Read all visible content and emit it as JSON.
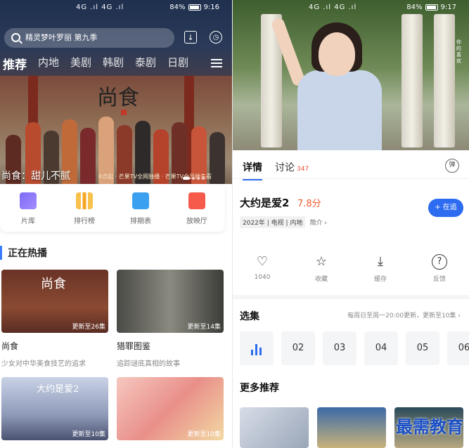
{
  "left": {
    "status": {
      "network": "4G .ıl 4G .ıl",
      "battery": "84%",
      "time": "9:16"
    },
    "search": {
      "placeholder": "精灵梦叶罗丽 第九季"
    },
    "nav_tabs": [
      "推荐",
      "内地",
      "美剧",
      "韩剧",
      "泰剧",
      "日剧"
    ],
    "banner": {
      "logo": "尚食",
      "caption": "尚食：甜儿不腻",
      "sub": "8点起 · 芒果TV全网独播 · 芒果TV会员抢先看"
    },
    "quick_links": [
      {
        "label": "片库",
        "icon": "grid-icon"
      },
      {
        "label": "排行榜",
        "icon": "chart-icon"
      },
      {
        "label": "排期表",
        "icon": "calendar-icon"
      },
      {
        "label": "放映厅",
        "icon": "play-icon"
      }
    ],
    "section_title": "正在热播",
    "cards": [
      {
        "title": "尚食",
        "subtitle": "少女对中华美食技艺的追求",
        "badge": "更新至26集",
        "logo": "尚食"
      },
      {
        "title": "猎罪图鉴",
        "subtitle": "追踪谜底真相的故事",
        "badge": "更新至14集",
        "logo": ""
      },
      {
        "title": "",
        "subtitle": "",
        "badge": "更新至10集",
        "logo": "大约是爱2"
      },
      {
        "title": "",
        "subtitle": "",
        "badge": "更新至10集",
        "logo": ""
      }
    ]
  },
  "right": {
    "status": {
      "network": "4G .ıl 4G .ıl",
      "battery": "84%",
      "time": "9:17"
    },
    "hero_tag": "你的喜欢",
    "tabs": [
      {
        "label": "详情"
      },
      {
        "label": "讨论",
        "count": "347"
      }
    ],
    "show": {
      "title": "大约是爱2",
      "score": "7.8分",
      "year": "2022年",
      "type": "电视",
      "region": "内地",
      "intro": "简介 ›"
    },
    "follow_label": "+ 在追",
    "actions": [
      {
        "label": "1040",
        "icon": "heart-icon",
        "glyph": "♡"
      },
      {
        "label": "收藏",
        "icon": "star-icon",
        "glyph": "☆"
      },
      {
        "label": "缓存",
        "icon": "download-icon",
        "glyph": "⤓"
      },
      {
        "label": "反馈",
        "icon": "help-icon",
        "glyph": "?"
      }
    ],
    "episodes_title": "选集",
    "episodes_note": "每周日至周一20:00更新，更新至10集  ›",
    "episodes": [
      "",
      "02",
      "03",
      "04",
      "05",
      "06"
    ],
    "more_title": "更多推荐",
    "watermark": "最需教育"
  },
  "colors": {
    "accent": "#2d6cf0",
    "score": "#ef5b2e",
    "comment_count": "#e8543a"
  }
}
